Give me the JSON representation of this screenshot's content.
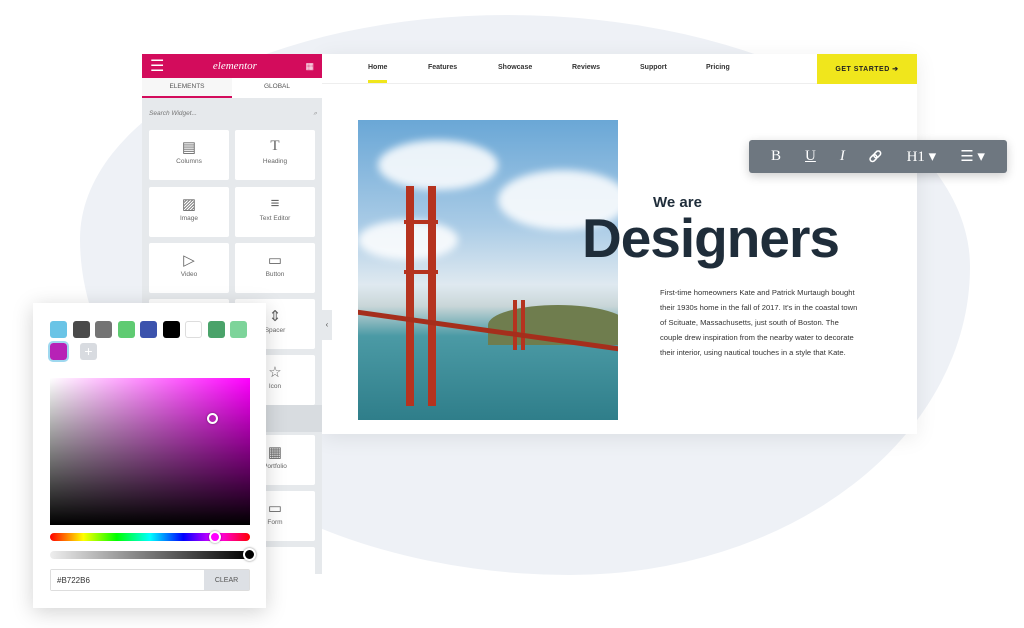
{
  "panel": {
    "logo": "elementor",
    "tabs": [
      "ELEMENTS",
      "GLOBAL"
    ],
    "search_placeholder": "Search Widget...",
    "widgets": [
      {
        "label": "Columns",
        "icon": "columns-icon"
      },
      {
        "label": "Heading",
        "icon": "heading-icon"
      },
      {
        "label": "Image",
        "icon": "image-icon"
      },
      {
        "label": "Text Editor",
        "icon": "text-editor-icon"
      },
      {
        "label": "Video",
        "icon": "video-icon"
      },
      {
        "label": "Button",
        "icon": "button-icon"
      },
      {
        "label": "Spacer",
        "icon": "spacer-icon"
      },
      {
        "label": "Icon",
        "icon": "star-icon"
      },
      {
        "label": "Portfolio",
        "icon": "portfolio-icon"
      },
      {
        "label": "Form",
        "icon": "form-icon"
      }
    ],
    "accent": "#d30c5c"
  },
  "site": {
    "nav": [
      "Home",
      "Features",
      "Showcase",
      "Reviews",
      "Support",
      "Pricing"
    ],
    "cta": "GET STARTED ➔",
    "cta_color": "#f0e61c",
    "kicker": "We are",
    "headline": "Designers",
    "paragraph": "First-time homeowners Kate and Patrick Murtaugh bought their 1930s home in the fall of 2017. It's in the coastal town of Scituate, Massachusetts, just south of Boston. The couple drew inspiration from the nearby water to decorate their interior, using nautical touches in a style that Kate."
  },
  "toolbar": {
    "bold": "B",
    "underline": "U",
    "italic": "I",
    "link": "🔗",
    "heading": "H1 ▾",
    "list": "☰ ▾"
  },
  "picker": {
    "swatches": [
      "#6ac4e6",
      "#4a4a4a",
      "#747474",
      "#5fcb72",
      "#3c53ad",
      "#000000",
      "#ffffff",
      "#4aa36a",
      "#7dd49a",
      "#b722b6"
    ],
    "add": "+",
    "hex": "#B722B6",
    "clear": "CLEAR"
  }
}
